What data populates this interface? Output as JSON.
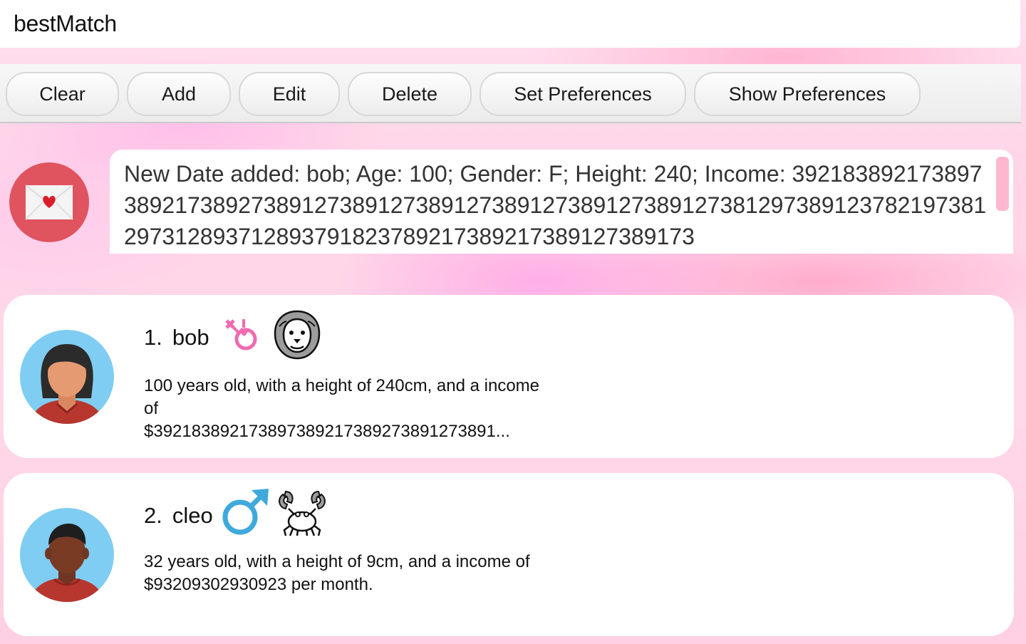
{
  "app": {
    "title": "bestMatch"
  },
  "toolbar": {
    "buttons": [
      {
        "label": "Clear"
      },
      {
        "label": "Add"
      },
      {
        "label": "Edit"
      },
      {
        "label": "Delete"
      },
      {
        "label": "Set Preferences"
      },
      {
        "label": "Show Preferences"
      }
    ]
  },
  "result": {
    "message": "New Date added: bob; Age: 100; Gender: F; Height: 240; Income: 39218389217389738921738927389127389127389127389127389127389127381297389123782197381297312893712893791823789217389217389127389173",
    "icon": "love-letter-icon"
  },
  "dates": [
    {
      "index": "1.",
      "name": "bob",
      "gender_icon": "female-gender-icon",
      "zodiac_icon": "leo-lion-icon",
      "details": "100 years old, with a height of 240cm, and a income of $392183892173897389217389273891273891...",
      "details_lines": [
        "100 years old, with a height of 240cm, and a income",
        "of",
        "$392183892173897389217389273891273891..."
      ],
      "avatar": "female-avatar"
    },
    {
      "index": "2.",
      "name": "cleo",
      "gender_icon": "male-gender-icon",
      "zodiac_icon": "cancer-crab-icon",
      "details_lines": [
        "32 years old, with a height of 9cm, and a income of",
        "$93209302930923 per month."
      ],
      "avatar": "male-avatar"
    }
  ],
  "colors": {
    "accent_pink": "#ffb7cf",
    "envelope_bg": "#e0545f",
    "avatar_bg": "#7fcdf2",
    "male_blue": "#3fa9dc",
    "female_pink": "#f06bb0"
  }
}
